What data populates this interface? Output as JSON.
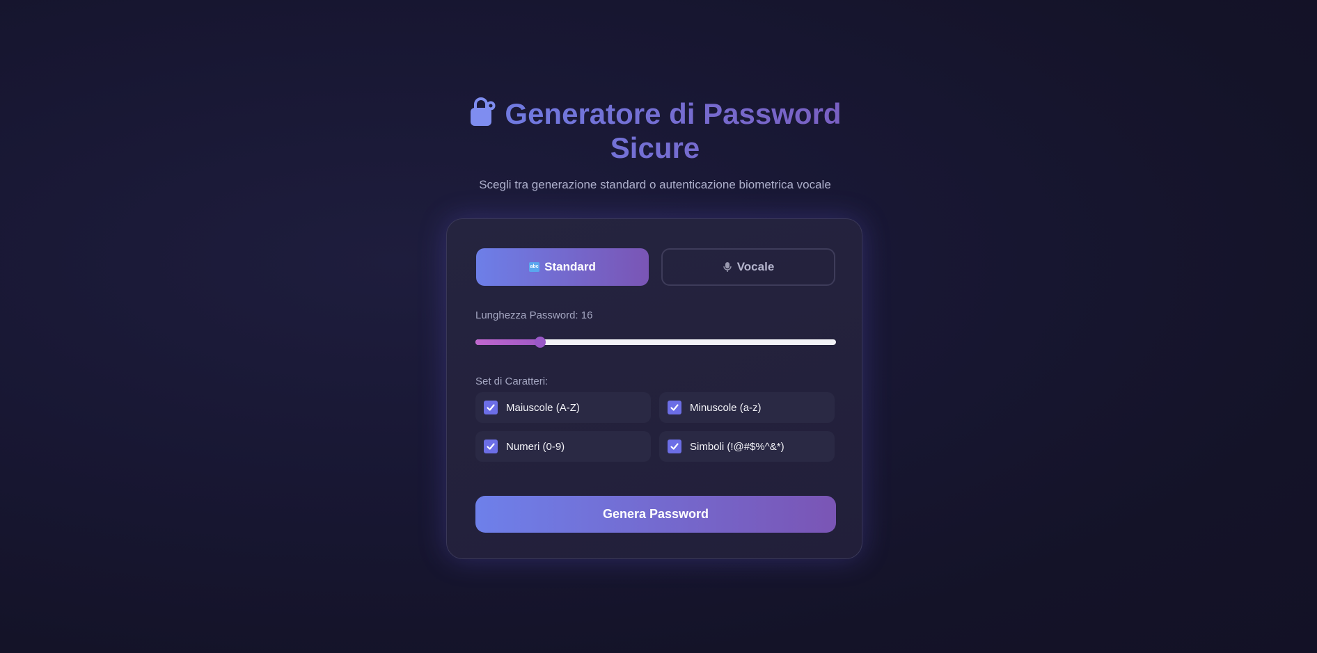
{
  "header": {
    "icon": "lock-icon",
    "title": "Generatore di Password Sicure",
    "subtitle": "Scegli tra generazione standard o autenticazione biometrica vocale"
  },
  "modes": {
    "standard": {
      "label": "Standard",
      "icon": "abc-icon",
      "active": true
    },
    "vocale": {
      "label": "Vocale",
      "icon": "microphone-icon",
      "active": false
    }
  },
  "length": {
    "label": "Lunghezza Password: 16",
    "value": 16,
    "fill_fraction": 0.18
  },
  "charsets": {
    "label": "Set di Caratteri:",
    "options": [
      {
        "label": "Maiuscole (A-Z)",
        "checked": true
      },
      {
        "label": "Minuscole (a-z)",
        "checked": true
      },
      {
        "label": "Numeri (0-9)",
        "checked": true
      },
      {
        "label": "Simboli (!@#$%^&*)",
        "checked": true
      }
    ]
  },
  "actions": {
    "generate_label": "Genera Password"
  },
  "colors": {
    "accent_start": "#6d7fe8",
    "accent_end": "#7a55b5",
    "slider_fill": "#c067cf",
    "background": "#181733"
  }
}
